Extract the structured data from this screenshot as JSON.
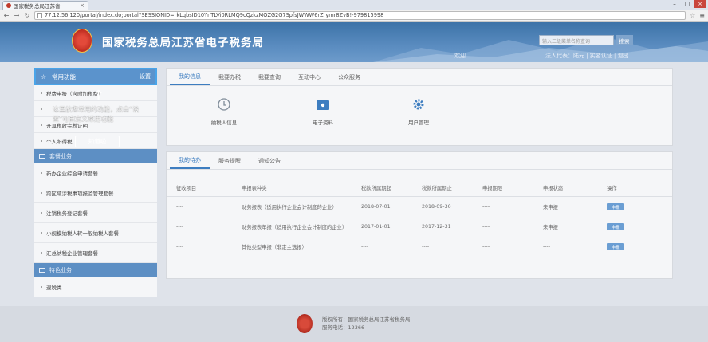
{
  "browser": {
    "tab_title": "国家税务总局江苏省",
    "url": "77.12.56.120/portal/index.do;portal?SESSIONID=rkLqbsID10YnTLVi0RLMQ9cQzkzMOZG2G7SpfsJWWW6rZrymr8ZvB!-979815998"
  },
  "header": {
    "site_title": "国家税务总局江苏省电子税务局",
    "search_placeholder": "输入二级菜单名称查询",
    "search_button": "搜索",
    "welcome": "欢迎",
    "user_links": "法人代表：陆元  |  实名认证  |  退出"
  },
  "sidebar": {
    "favorites_label": "常用功能",
    "favorites_settings": "设置",
    "favorite_items": [
      "税费申报（含附加税费）",
      "",
      "开具税收完税证明",
      "个人所得税…"
    ],
    "section1_title": "套餐业务",
    "section1_items": [
      "新办企业综合申请套餐",
      "跨区域涉税事项报验管理套餐",
      "注销税务登记套餐",
      "小规模纳税人转一般纳税人套餐",
      "汇总纳税企业管理套餐"
    ],
    "section2_title": "特色业务",
    "section2_items": [
      "退税类"
    ]
  },
  "tooltip": {
    "text": "这里放您常用的功能，点击“设置”可自定义常用功能",
    "button": "知道啦"
  },
  "info_panel": {
    "tabs": [
      "我的信息",
      "我要办税",
      "我要查询",
      "互动中心",
      "公众服务"
    ],
    "shortcuts": [
      "纳税人信息",
      "电子资料",
      "用户管理"
    ]
  },
  "task_panel": {
    "tabs": [
      "我的待办",
      "服务提醒",
      "通知公告"
    ],
    "columns": [
      "征收项目",
      "申报表种类",
      "税款所属期起",
      "税款所属期止",
      "申报期限",
      "申报状态",
      "操作"
    ],
    "rows": [
      {
        "item": "----",
        "form": "财务报表（适用执行企业会计制度的企业）",
        "start": "2018-07-01",
        "end": "2018-09-30",
        "deadline": "----",
        "status": "未申报",
        "action": "申报"
      },
      {
        "item": "----",
        "form": "财务报表年报（适用执行企业会计制度的企业）",
        "start": "2017-01-01",
        "end": "2017-12-31",
        "deadline": "----",
        "status": "未申报",
        "action": "申报"
      },
      {
        "item": "----",
        "form": "其他类型申报（非定主选报）",
        "start": "----",
        "end": "----",
        "deadline": "----",
        "status": "----",
        "action": "申报"
      }
    ]
  },
  "footer": {
    "line1": "版权所有：国家税务总局江苏省税务局",
    "line2": "服务电话：12366"
  },
  "colors": {
    "banner": "#3d73a8",
    "accent": "#3d7dc0",
    "sidebar_header": "#5d8fc4"
  }
}
